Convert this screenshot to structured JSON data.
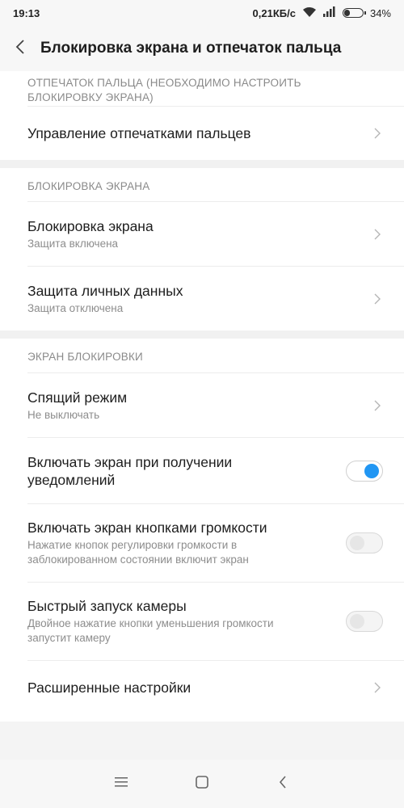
{
  "status_bar": {
    "time": "19:13",
    "speed": "0,21КБ/с",
    "battery_percent": "34%",
    "battery_level": 0.34
  },
  "header": {
    "title": "Блокировка экрана и отпечаток пальца"
  },
  "sections": [
    {
      "header": "ОТПЕЧАТОК ПАЛЬЦА (НЕОБХОДИМО НАСТРОИТЬ БЛОКИРОВКУ ЭКРАНА)",
      "items": [
        {
          "label": "Управление отпечатками пальцев"
        }
      ]
    },
    {
      "header": "БЛОКИРОВКА ЭКРАНА",
      "items": [
        {
          "label": "Блокировка экрана",
          "sub": "Защита включена"
        },
        {
          "label": "Защита личных данных",
          "sub": "Защита отключена"
        }
      ]
    },
    {
      "header": "ЭКРАН БЛОКИРОВКИ",
      "items": [
        {
          "label": "Спящий режим",
          "sub": "Не выключать"
        },
        {
          "label": "Включать экран при получении уведомлений",
          "toggle": true
        },
        {
          "label": "Включать экран кнопками громкости",
          "sub": "Нажатие кнопок регулировки громкости в заблокированном состоянии включит экран",
          "toggle": false
        },
        {
          "label": "Быстрый запуск камеры",
          "sub": "Двойное нажатие кнопки уменьшения громкости запустит камеру",
          "toggle": false
        },
        {
          "label": "Расширенные настройки"
        }
      ]
    }
  ],
  "colors": {
    "accent": "#2196f3",
    "background": "#f4f4f4",
    "card": "#ffffff"
  }
}
